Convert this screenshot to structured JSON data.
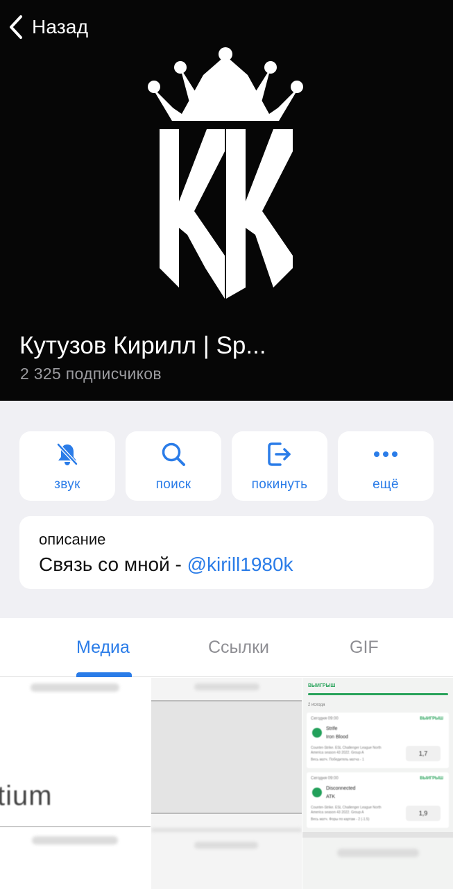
{
  "header": {
    "back_label": "Назад",
    "title": "Кутузов Кирилл | Sp...",
    "subscribers": "2 325 подписчиков",
    "logo_text": "KK"
  },
  "actions": [
    {
      "label": "звук",
      "icon": "bell-muted-icon"
    },
    {
      "label": "поиск",
      "icon": "search-icon"
    },
    {
      "label": "покинуть",
      "icon": "leave-icon"
    },
    {
      "label": "ещё",
      "icon": "more-icon"
    }
  ],
  "description": {
    "label": "описание",
    "text": "Связь со мной - ",
    "link": "@kirill1980k"
  },
  "tabs": [
    {
      "label": "Медиа",
      "active": true
    },
    {
      "label": "Ссылки",
      "active": false
    },
    {
      "label": "GIF",
      "active": false
    }
  ],
  "media": {
    "thumb1_text": "tium",
    "thumb3": {
      "header": "ВЫИГРЫШ",
      "outcomes": "2 исхода",
      "bets": [
        {
          "time": "Сегодня 09:00",
          "status": "ВЫИГРЫШ",
          "team1": "Strife",
          "team2": "Iron Blood",
          "league": "Counter-Strike. ESL Challenger League North",
          "league2": "America season 43 2022. Group A",
          "market": "Весь матч. Победитель матча - 1",
          "odd": "1,7"
        },
        {
          "time": "Сегодня 09:00",
          "status": "ВЫИГРЫШ",
          "team1": "Disconnected",
          "team2": "ATK",
          "league": "Counter-Strike. ESL Challenger League North",
          "league2": "America season 43 2022. Group A",
          "market": "Весь матч. Форы по картам - 2 (-1.5)",
          "odd": "1,9"
        }
      ]
    }
  },
  "colors": {
    "accent": "#2a7ce8",
    "header_bg": "#060606",
    "win_green": "#29a35b"
  }
}
